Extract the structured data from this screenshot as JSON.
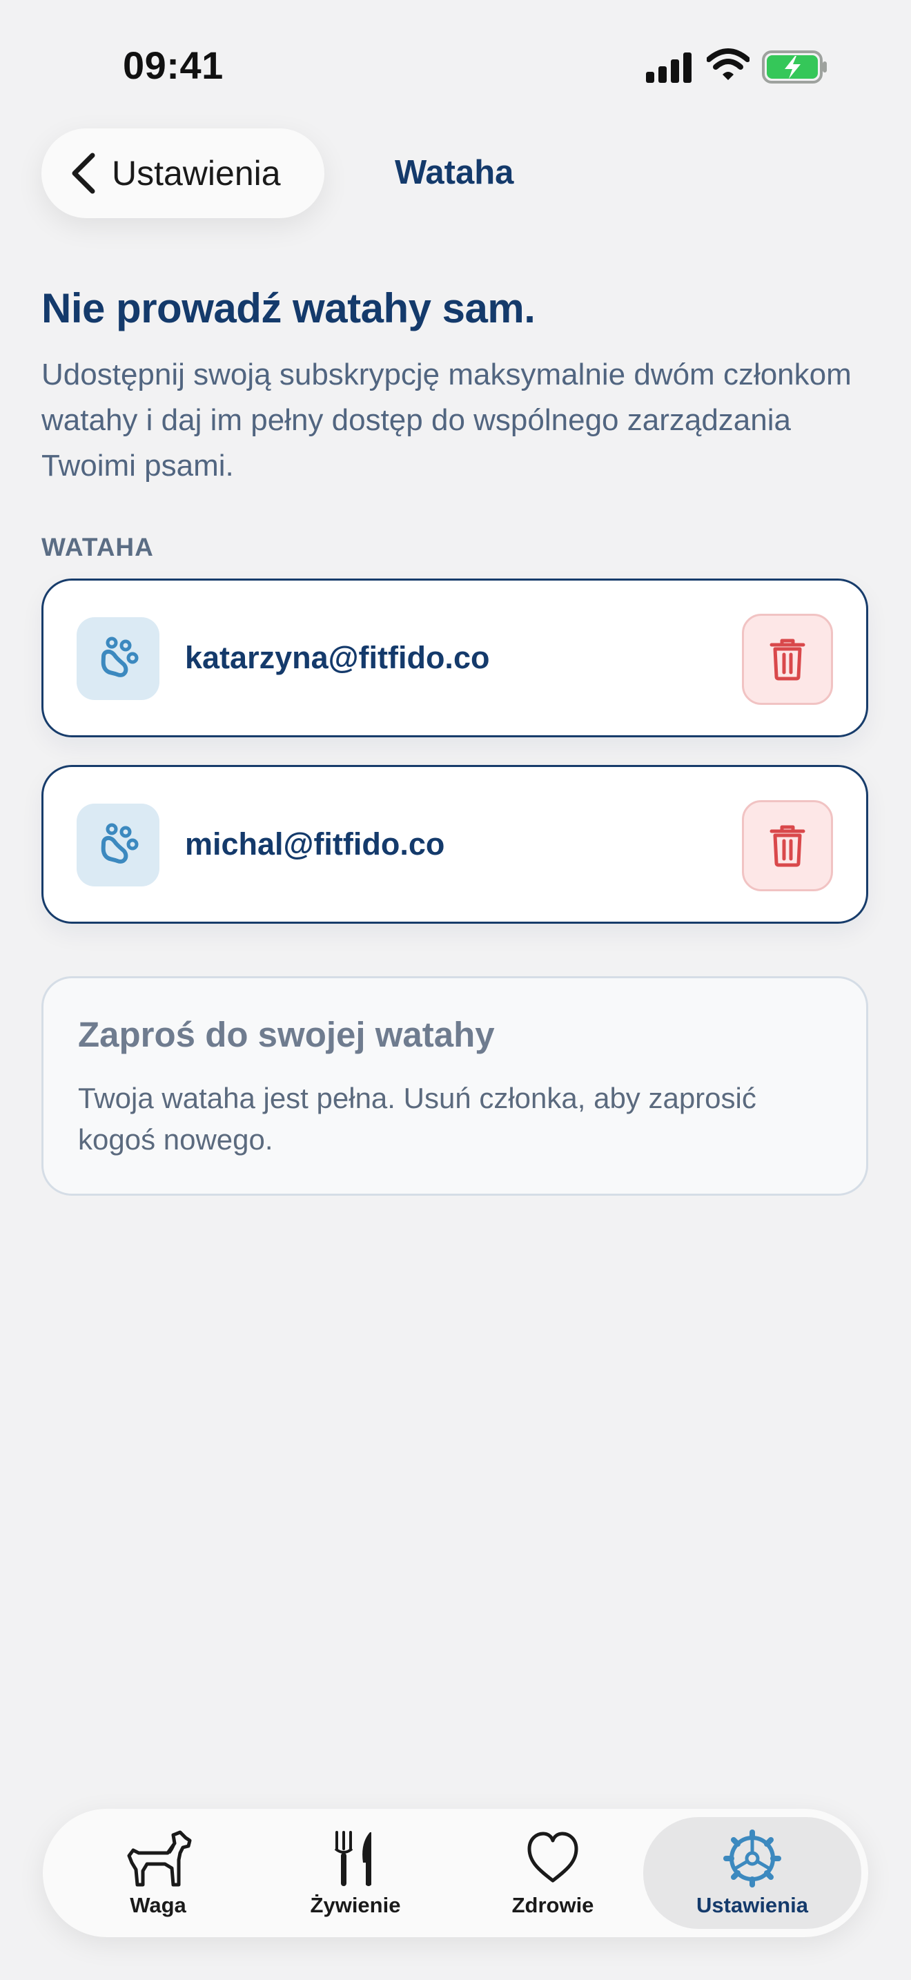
{
  "status": {
    "time": "09:41"
  },
  "nav": {
    "back_label": "Ustawienia",
    "title": "Wataha"
  },
  "intro": {
    "heading": "Nie prowadź watahy sam.",
    "description": "Udostępnij swoją subskrypcję maksymalnie dwóm członkom watahy i daj im pełny dostęp do wspólnego zarządzania Twoimi psami."
  },
  "section_label": "WATAHA",
  "members": [
    {
      "email": "katarzyna@fitfido.co",
      "icon": "paw-icon",
      "action_icon": "trash-icon"
    },
    {
      "email": "michal@fitfido.co",
      "icon": "paw-icon",
      "action_icon": "trash-icon"
    }
  ],
  "invite": {
    "title": "Zaproś do swojej watahy",
    "message": "Twoja wataha jest pełna. Usuń członka, aby zaprosić kogoś nowego."
  },
  "tabs": [
    {
      "label": "Waga",
      "icon": "dog-icon"
    },
    {
      "label": "Żywienie",
      "icon": "fork-knife-icon"
    },
    {
      "label": "Zdrowie",
      "icon": "heart-icon"
    },
    {
      "label": "Ustawienia",
      "icon": "settings-gear-icon",
      "active": true
    }
  ],
  "colors": {
    "primary": "#143a6b",
    "accent": "#3c89bf",
    "danger": "#d9484b",
    "danger_bg": "#fde7e7",
    "background": "#f2f2f3"
  }
}
